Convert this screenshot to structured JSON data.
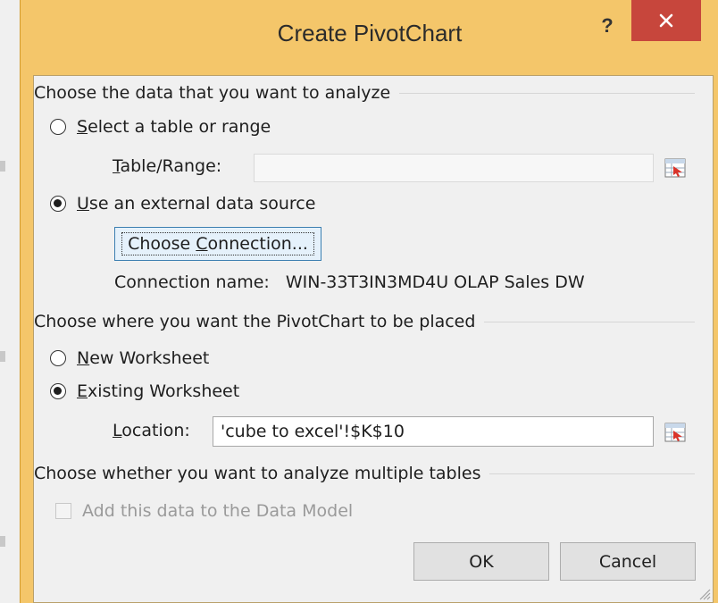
{
  "dialog": {
    "title": "Create PivotChart",
    "help_label": "?",
    "close_icon": "close-icon"
  },
  "data_section": {
    "heading": "Choose the data that you want to analyze",
    "select_table_first": "S",
    "select_table_rest": "elect a table or range",
    "table_range_first": "T",
    "table_range_rest": "able/Range:",
    "table_range_value": "",
    "external_first": "U",
    "external_rest": "se an external data source",
    "choose_conn_pre": "Choose ",
    "choose_conn_u": "C",
    "choose_conn_post": "onnection...",
    "connection_label": "Connection name:",
    "connection_value": "WIN-33T3IN3MD4U OLAP Sales DW",
    "selected": "external"
  },
  "placement_section": {
    "heading": "Choose where you want the PivotChart to be placed",
    "new_first": "N",
    "new_rest": "ew Worksheet",
    "existing_first": "E",
    "existing_rest": "xisting Worksheet",
    "location_first": "L",
    "location_rest": "ocation:",
    "location_value": "'cube to excel'!$K$10",
    "selected": "existing"
  },
  "multi_section": {
    "heading": "Choose whether you want to analyze multiple tables",
    "data_model_label": "Add this data to the Data Model",
    "data_model_checked": false
  },
  "buttons": {
    "ok": "OK",
    "cancel": "Cancel"
  },
  "colors": {
    "title_bar": "#f4c66a",
    "close_button": "#c7463c",
    "client_bg": "#f0f0f0"
  }
}
